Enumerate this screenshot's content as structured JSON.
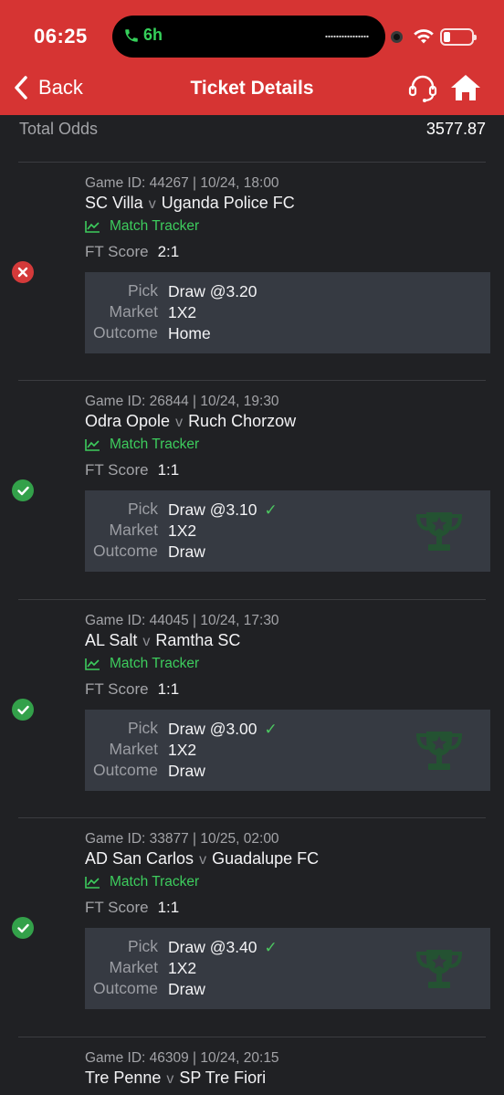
{
  "status_bar": {
    "time": "06:25",
    "call_duration": "6h"
  },
  "header": {
    "back_label": "Back",
    "title": "Ticket Details"
  },
  "summary": {
    "total_odds_label": "Total Odds",
    "total_odds_value": "3577.87"
  },
  "labels": {
    "tracker": "Match Tracker",
    "ft_score": "FT Score",
    "pick": "Pick",
    "market": "Market",
    "outcome": "Outcome",
    "vs": "v"
  },
  "tickets": [
    {
      "status": "lost",
      "meta": "Game ID: 44267 | 10/24, 18:00",
      "home": "SC Villa",
      "away": "Uganda Police FC",
      "score": "2:1",
      "pick": "Draw @3.20",
      "market": "1X2",
      "outcome": "Home"
    },
    {
      "status": "won",
      "meta": "Game ID: 26844 | 10/24, 19:30",
      "home": "Odra Opole",
      "away": "Ruch Chorzow",
      "score": "1:1",
      "pick": "Draw @3.10",
      "market": "1X2",
      "outcome": "Draw"
    },
    {
      "status": "won",
      "meta": "Game ID: 44045 | 10/24, 17:30",
      "home": "AL Salt",
      "away": "Ramtha SC",
      "score": "1:1",
      "pick": "Draw @3.00",
      "market": "1X2",
      "outcome": "Draw"
    },
    {
      "status": "won",
      "meta": "Game ID: 33877 | 10/25, 02:00",
      "home": "AD San Carlos",
      "away": "Guadalupe FC",
      "score": "1:1",
      "pick": "Draw @3.40",
      "market": "1X2",
      "outcome": "Draw"
    }
  ],
  "partial_ticket": {
    "meta": "Game ID: 46309 | 10/24, 20:15",
    "home": "Tre Penne",
    "away": "SP Tre Fiori"
  },
  "colors": {
    "brand_red": "#d63433",
    "win_green": "#33a14a",
    "loss_red": "#d43a3a",
    "tracker_green": "#3dcc5d"
  }
}
